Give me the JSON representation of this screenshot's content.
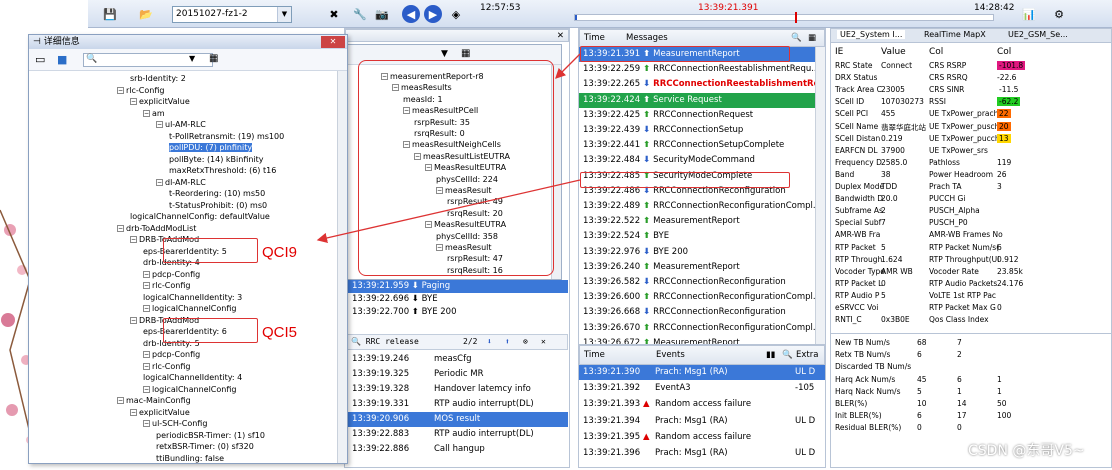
{
  "toolbar": {
    "combo_value": "20151027-fz1-2",
    "time_left": "12:57:53",
    "time_mid": "13:39:21.391",
    "time_right": "14:28:42"
  },
  "detail": {
    "title": "详细信息",
    "close": "✕",
    "tree": [
      "srb-Identity: 2",
      "rlc-Config",
      "explicitValue",
      "am",
      "ul-AM-RLC",
      "t-PollRetransmit: (19) ms100",
      "pollPDU: (7) pInfinity",
      "pollByte: (14) kBinfinity",
      "maxRetxThreshold: (6) t16",
      "dl-AM-RLC",
      "t-Reordering: (10) ms50",
      "t-StatusProhibit: (0) ms0",
      "logicalChannelConfig: defaultValue",
      "drb-ToAddModList",
      "DRB-ToAddMod",
      "eps-BearerIdentity: 5",
      "drb-Identity: 4",
      "pdcp-Config",
      "rlc-Config",
      "logicalChannelIdentity: 3",
      "logicalChannelConfig",
      "DRB-ToAddMod",
      "eps-BearerIdentity: 6",
      "drb-Identity: 5",
      "pdcp-Config",
      "rlc-Config",
      "logicalChannelIdentity: 4",
      "logicalChannelConfig",
      "mac-MainConfig",
      "explicitValue",
      "ul-SCH-Config",
      "periodicBSR-Timer: (1) sf10",
      "retxBSR-Timer: (0) sf320",
      "ttiBundling: false"
    ],
    "qci9": "QCI9",
    "qci5": "QCI5"
  },
  "meas": {
    "close": "✕",
    "tree": [
      "measurementReport-r8",
      "measResults",
      "measId: 1",
      "measResultPCell",
      "rsrpResult: 35",
      "rsrqResult: 0",
      "measResultNeighCells",
      "measResultListEUTRA",
      "MeasResultEUTRA",
      "physCellId: 224",
      "measResult",
      "rsrpResult: 49",
      "rsrqResult: 20",
      "MeasResultEUTRA",
      "physCellId: 358",
      "measResult",
      "rsrpResult: 47",
      "rsrqResult: 16"
    ]
  },
  "midlist": {
    "rows": [
      {
        "t": "13:39:21.959",
        "m": "Paging"
      },
      {
        "t": "13:39:22.696",
        "m": "BYE"
      },
      {
        "t": "13:39:22.700",
        "m": "BYE 200"
      }
    ]
  },
  "search": {
    "value": "RRC release",
    "count": "2/2"
  },
  "events_mid": [
    {
      "t": "13:39:19.246",
      "m": "measCfg"
    },
    {
      "t": "13:39:19.325",
      "m": "Periodic MR"
    },
    {
      "t": "13:39:19.328",
      "m": "Handover latemcy info"
    },
    {
      "t": "13:39:19.331",
      "m": "RTP audio interrupt(DL)"
    },
    {
      "t": "13:39:20.906",
      "m": "MOS result"
    },
    {
      "t": "13:39:22.883",
      "m": "RTP audio interrupt(DL)"
    },
    {
      "t": "13:39:22.886",
      "m": "Call hangup"
    }
  ],
  "messages": {
    "h_time": "Time",
    "h_msg": "Messages",
    "rows": [
      {
        "t": "13:39:21.391",
        "d": "up",
        "m": "MeasurementReport",
        "sel": true
      },
      {
        "t": "13:39:22.259",
        "d": "up",
        "m": "RRCConnectionReestablishmentRequ..."
      },
      {
        "t": "13:39:22.265",
        "d": "dn",
        "m": "RRCConnectionReestablishmentReject",
        "red": true
      },
      {
        "t": "13:39:22.424",
        "d": "up",
        "m": "Service Request",
        "green": true
      },
      {
        "t": "13:39:22.425",
        "d": "up",
        "m": "RRCConnectionRequest"
      },
      {
        "t": "13:39:22.439",
        "d": "dn",
        "m": "RRCConnectionSetup"
      },
      {
        "t": "13:39:22.441",
        "d": "up",
        "m": "RRCConnectionSetupComplete"
      },
      {
        "t": "13:39:22.484",
        "d": "dn",
        "m": "SecurityModeCommand"
      },
      {
        "t": "13:39:22.485",
        "d": "up",
        "m": "SecurityModeComplete"
      },
      {
        "t": "13:39:22.486",
        "d": "dn",
        "m": "RRCConnectionReconfiguration"
      },
      {
        "t": "13:39:22.489",
        "d": "up",
        "m": "RRCConnectionReconfigurationCompl..."
      },
      {
        "t": "13:39:22.522",
        "d": "up",
        "m": "MeasurementReport"
      },
      {
        "t": "13:39:22.524",
        "d": "up",
        "m": "BYE"
      },
      {
        "t": "13:39:22.976",
        "d": "dn",
        "m": "BYE 200"
      },
      {
        "t": "13:39:26.240",
        "d": "up",
        "m": "MeasurementReport"
      },
      {
        "t": "13:39:26.582",
        "d": "dn",
        "m": "RRCConnectionReconfiguration"
      },
      {
        "t": "13:39:26.600",
        "d": "up",
        "m": "RRCConnectionReconfigurationCompl..."
      },
      {
        "t": "13:39:26.668",
        "d": "dn",
        "m": "RRCConnectionReconfiguration"
      },
      {
        "t": "13:39:26.670",
        "d": "up",
        "m": "RRCConnectionReconfigurationCompl..."
      },
      {
        "t": "13:39:26.672",
        "d": "up",
        "m": "MeasurementReport"
      }
    ]
  },
  "events": {
    "h_time": "Time",
    "h_ev": "Events",
    "h_ex": "Extra",
    "rows": [
      {
        "t": "13:39:21.390",
        "e": "Prach: Msg1 (RA)",
        "x": "UL D",
        "sel": true
      },
      {
        "t": "13:39:21.392",
        "e": "EventA3",
        "x": "-105"
      },
      {
        "t": "13:39:21.393",
        "e": "Random access failure",
        "warn": true,
        "x": ""
      },
      {
        "t": "13:39:21.394",
        "e": "Prach: Msg1 (RA)",
        "x": "UL D"
      },
      {
        "t": "13:39:21.395",
        "e": "Random access failure",
        "warn": true,
        "x": ""
      },
      {
        "t": "13:39:21.396",
        "e": "Prach: Msg1 (RA)",
        "x": "UL D"
      }
    ]
  },
  "stats": {
    "tabs": [
      "UE2_System I...",
      "RealTime MapX",
      "UE2_GSM_Se..."
    ],
    "headers": [
      "IE",
      "Value",
      "Col",
      "Col"
    ],
    "rows": [
      [
        "RRC State",
        "Connect",
        "CRS RSRP",
        "-101.8"
      ],
      [
        "DRX Status",
        "",
        "CRS RSRQ",
        "-22.6"
      ],
      [
        "Track Area C",
        "23005",
        "CRS SINR",
        "-11.5"
      ],
      [
        "SCell ID",
        "107030273",
        "RSSI",
        "-62.2"
      ],
      [
        "SCell PCI",
        "455",
        "UE TxPower_prach",
        "22"
      ],
      [
        "SCell Name",
        "翡翠华庭北站",
        "UE TxPower_pusch",
        "20"
      ],
      [
        "SCell Distan",
        "0.219",
        "UE TxPower_pucch",
        "13"
      ],
      [
        "EARFCN DL",
        "37900",
        "UE TxPower_srs",
        ""
      ],
      [
        "Frequency D",
        "2585.0",
        "Pathloss",
        "119"
      ],
      [
        "Band",
        "38",
        "Power Headroom",
        "26"
      ],
      [
        "Duplex Mode",
        "TDD",
        "Prach TA",
        "3"
      ],
      [
        "Bandwidth D",
        "20.0",
        "PUCCH Gi",
        ""
      ],
      [
        "Subframe As",
        "2",
        "PUSCH_Alpha",
        ""
      ],
      [
        "Special Subf",
        "7",
        "PUSCH_P0",
        ""
      ],
      [
        "AMR-WB Fra",
        "",
        "AMR-WB Frames No",
        ""
      ],
      [
        "RTP Packet",
        "5",
        "RTP Packet Num/s(",
        "6"
      ],
      [
        "RTP Through",
        "1.624",
        "RTP Throughput(UI",
        "0.912"
      ],
      [
        "Vocoder Type",
        "AMR WB",
        "Vocoder Rate",
        "23.85k"
      ],
      [
        "RTP Packet L",
        "0",
        "RTP Audio Packets",
        "24.176"
      ],
      [
        "RTP Audio P",
        "5",
        "VoLTE 1st RTP Pac",
        ""
      ],
      [
        "eSRVCC Voi",
        "",
        "RTP Packet Max G",
        "0"
      ],
      [
        "RNTI_C",
        "0x3B0E",
        "Qos Class Index",
        ""
      ]
    ],
    "bottom": [
      [
        "New TB Num/s",
        "68",
        "7",
        ""
      ],
      [
        "Retx TB Num/s",
        "6",
        "2",
        ""
      ],
      [
        "Discarded TB Num/s",
        "",
        "",
        ""
      ],
      [
        "Harq Ack Num/s",
        "45",
        "6",
        "1"
      ],
      [
        "Harq Nack Num/s",
        "5",
        "1",
        "1"
      ],
      [
        "BLER(%)",
        "10",
        "14",
        "50"
      ],
      [
        "Init BLER(%)",
        "6",
        "17",
        "100"
      ],
      [
        "Residual BLER(%)",
        "0",
        "0",
        ""
      ]
    ]
  },
  "watermark": "CSDN @东哥V5~",
  "colors": {
    "select": "#3b78d8",
    "highlight_red": "#d33",
    "rsrp": "#e0177f",
    "rssi": "#22cc22",
    "tx22": "#ff6a00",
    "tx13": "#ffd700"
  }
}
